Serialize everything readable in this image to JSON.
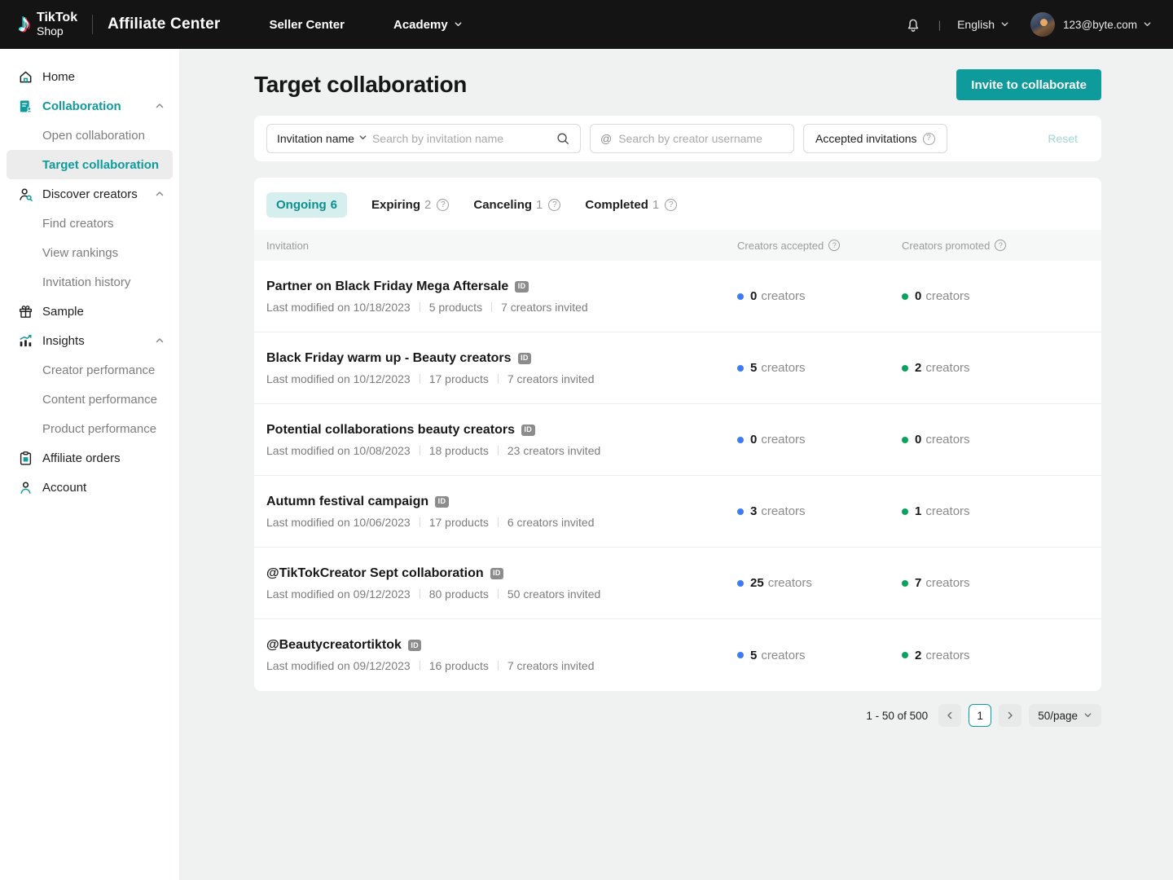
{
  "header": {
    "brand_line1": "TikTok",
    "brand_line2": "Shop",
    "app_title": "Affiliate Center",
    "nav_seller_center": "Seller Center",
    "nav_academy": "Academy",
    "language": "English",
    "account_email": "123@byte.com"
  },
  "sidebar": {
    "items": [
      {
        "label": "Home",
        "icon": "home",
        "type": "top"
      },
      {
        "label": "Collaboration",
        "icon": "collaboration",
        "type": "top",
        "accent": true,
        "expandable": true
      },
      {
        "label": "Open collaboration",
        "type": "sub"
      },
      {
        "label": "Target collaboration",
        "type": "sub",
        "active": true
      },
      {
        "label": "Discover creators",
        "icon": "discover-creators",
        "type": "top",
        "expandable": true
      },
      {
        "label": "Find creators",
        "type": "sub"
      },
      {
        "label": "View rankings",
        "type": "sub"
      },
      {
        "label": "Invitation history",
        "type": "sub"
      },
      {
        "label": "Sample",
        "icon": "sample",
        "type": "top"
      },
      {
        "label": "Insights",
        "icon": "insights",
        "type": "top",
        "expandable": true
      },
      {
        "label": "Creator performance",
        "type": "sub"
      },
      {
        "label": "Content performance",
        "type": "sub"
      },
      {
        "label": "Product performance",
        "type": "sub"
      },
      {
        "label": "Affiliate orders",
        "icon": "affiliate-orders",
        "type": "top"
      },
      {
        "label": "Account",
        "icon": "account",
        "type": "top"
      }
    ]
  },
  "page": {
    "title": "Target collaboration",
    "invite_button_label": "Invite to collaborate"
  },
  "filters": {
    "field_selector_value": "Invitation name",
    "invitation_search_placeholder": "Search by invitation name",
    "username_prefix": "@",
    "username_search_placeholder": "Search by creator username",
    "accepted_invitations_label": "Accepted invitations",
    "reset_label": "Reset"
  },
  "tabs": [
    {
      "label": "Ongoing",
      "count": "6",
      "active": true,
      "help": false
    },
    {
      "label": "Expiring",
      "count": "2",
      "active": false,
      "help": true
    },
    {
      "label": "Canceling",
      "count": "1",
      "active": false,
      "help": true
    },
    {
      "label": "Completed",
      "count": "1",
      "active": false,
      "help": true
    }
  ],
  "table": {
    "columns": [
      {
        "label": "Invitation",
        "help": false
      },
      {
        "label": "Creators accepted",
        "help": true
      },
      {
        "label": "Creators promoted",
        "help": true
      }
    ],
    "id_badge": "ID",
    "creators_unit": "creators",
    "rows": [
      {
        "title": "Partner on Black Friday Mega Aftersale",
        "last_modified": "Last modified on 10/18/2023",
        "products": "5 products",
        "creators_invited": "7 creators invited",
        "accepted_count": "0",
        "promoted_count": "0"
      },
      {
        "title": "Black Friday warm up - Beauty creators",
        "last_modified": "Last modified on 10/12/2023",
        "products": "17 products",
        "creators_invited": "7 creators invited",
        "accepted_count": "5",
        "promoted_count": "2"
      },
      {
        "title": "Potential collaborations beauty creators",
        "last_modified": "Last modified on 10/08/2023",
        "products": "18 products",
        "creators_invited": "23 creators invited",
        "accepted_count": "0",
        "promoted_count": "0"
      },
      {
        "title": "Autumn festival campaign",
        "last_modified": "Last modified on 10/06/2023",
        "products": "17 products",
        "creators_invited": "6 creators invited",
        "accepted_count": "3",
        "promoted_count": "1"
      },
      {
        "title": "@TikTokCreator Sept collaboration",
        "last_modified": "Last modified on 09/12/2023",
        "products": "80 products",
        "creators_invited": "50 creators invited",
        "accepted_count": "25",
        "promoted_count": "7"
      },
      {
        "title": "@Beautycreatortiktok",
        "last_modified": "Last modified on 09/12/2023",
        "products": "16 products",
        "creators_invited": "7 creators invited",
        "accepted_count": "5",
        "promoted_count": "2"
      }
    ]
  },
  "pagination": {
    "range_text": "1 - 50 of 500",
    "current_page": "1",
    "page_size": "50/page"
  },
  "colors": {
    "accent_teal": "#0f9b9b",
    "accent_teal_light": "#d7eeee",
    "accepted_dot_blue": "#3b7cf5",
    "promoted_dot_green": "#07a35c",
    "header_bg": "#141414"
  }
}
